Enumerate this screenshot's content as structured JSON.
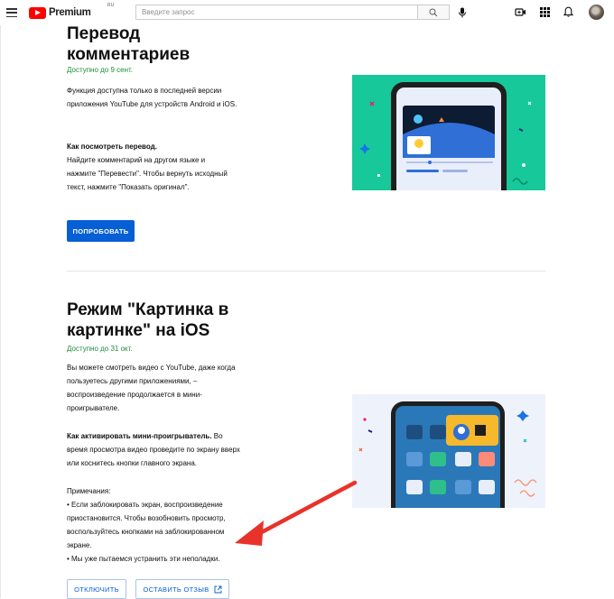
{
  "header": {
    "brand": "Premium",
    "region": "RU",
    "search_placeholder": "Введите запрос"
  },
  "features": [
    {
      "title_line1": "Перевод",
      "title_line2": "комментариев",
      "availability": "Доступно до 9 сент.",
      "paragraphs": [
        "Функция доступна только в последней версии приложения YouTube для устройств Android и iOS."
      ],
      "howto_heading": "Как посмотреть перевод.",
      "howto_text": "Найдите комментарий на другом языке и нажмите \"Перевести\". Чтобы вернуть исходный текст, нажмите \"Показать оригинал\".",
      "button_label": "ПОПРОБОВАТЬ",
      "illustration": "comment-translation-illustration"
    },
    {
      "title_line1": "Режим \"Картинка в",
      "title_line2": "картинке\" на iOS",
      "availability": "Доступно до 31 окт.",
      "paragraphs": [
        "Вы можете смотреть видео с YouTube, даже когда пользуетесь другими приложениями, – воспроизведение продолжается в мини-проигрывателе."
      ],
      "howto_heading": "Как активировать мини-проигрыватель.",
      "howto_text": "Во время просмотра видео проведите по экрану вверх или коснитесь кнопки главного экрана.",
      "notes_heading": "Примечания:",
      "note_1": "• Если заблокировать экран, воспроизведение приостановится. Чтобы возобновить просмотр, воспользуйтесь кнопками на заблокированном экране.",
      "note_2": "• Мы уже пытаемся устранить эти неполадки.",
      "disable_label": "ОТКЛЮЧИТЬ",
      "feedback_label": "ОСТАВИТЬ ОТЗЫВ",
      "illustration": "picture-in-picture-illustration"
    }
  ],
  "colors": {
    "brand_red": "#ff0000",
    "primary_blue": "#065fd4",
    "availability_green": "#1e8e3e",
    "annotation_arrow": "#e8332a",
    "illustration_teal": "#16c89a",
    "illustration_light": "#eef2fb"
  }
}
